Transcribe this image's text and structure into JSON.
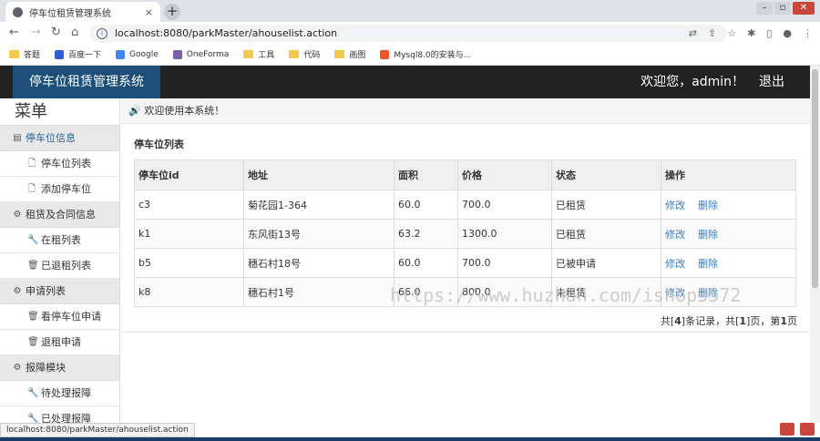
{
  "browser": {
    "tab_title": "停车位租赁管理系统",
    "tab_close": "×",
    "new_tab": "+",
    "url": "localhost:8080/parkMaster/ahouselist.action",
    "status_url": "localhost:8080/parkMaster/ahouselist.action",
    "bookmarks": [
      "答题",
      "百度一下",
      "Google",
      "OneForma",
      "工具",
      "代码",
      "画图",
      "Mysql8.0的安装与..."
    ]
  },
  "header": {
    "brand": "停车位租赁管理系统",
    "welcome": "欢迎您，admin！",
    "logout": "退出"
  },
  "sidebar": {
    "title": "菜单",
    "groups": [
      {
        "label": "停车位信息",
        "items": [
          "停车位列表",
          "添加停车位"
        ]
      },
      {
        "label": "租赁及合同信息",
        "items": [
          "在租列表",
          "已退租列表"
        ]
      },
      {
        "label": "申请列表",
        "items": [
          "看停车位申请",
          "退租申请"
        ]
      },
      {
        "label": "报障模块",
        "items": [
          "待处理报障",
          "已处理报障"
        ]
      }
    ]
  },
  "main": {
    "notice": "欢迎使用本系统！",
    "panel_title": "停车位列表",
    "columns": [
      "停车位id",
      "地址",
      "面积",
      "价格",
      "状态",
      "操作"
    ],
    "rows": [
      {
        "id": "c3",
        "address": "菊花园1-364",
        "area": "60.0",
        "price": "700.0",
        "status": "已租赁"
      },
      {
        "id": "k1",
        "address": "东风街13号",
        "area": "63.2",
        "price": "1300.0",
        "status": "已租赁"
      },
      {
        "id": "b5",
        "address": "穗石村18号",
        "area": "60.0",
        "price": "700.0",
        "status": "已被申请"
      },
      {
        "id": "k8",
        "address": "穗石村1号",
        "area": "66.0",
        "price": "800.0",
        "status": "未租赁"
      }
    ],
    "edit_label": "修改",
    "delete_label": "删除",
    "pager": {
      "pre": "共[",
      "total": "4",
      "mid1": "]条记录，共[",
      "pages": "1",
      "mid2": "]页，第",
      "current": "1",
      "post": "页"
    }
  },
  "watermark": "https://www.huzhan.com/ishop3572",
  "colors": {
    "brand_bg": "#1b4f7a",
    "header_bg": "#222222",
    "link": "#3a7bbf"
  }
}
